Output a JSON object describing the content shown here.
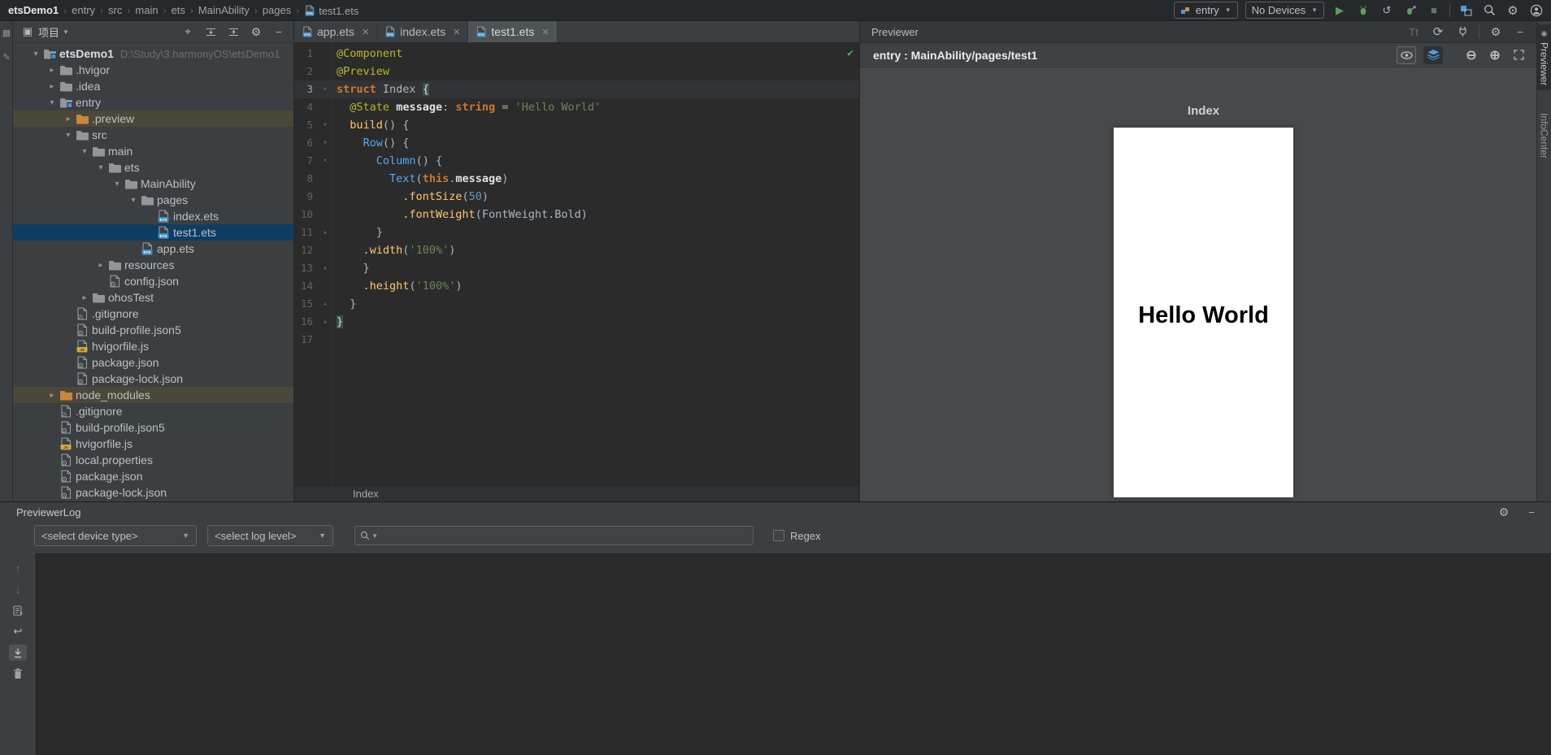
{
  "colors": {
    "editor_bg": "#2b2b2b",
    "panel_bg": "#3c3f41",
    "preview_surface": "#47494b",
    "selection_blue": "#0e3d64",
    "library_row_olive": "#4b4839",
    "annotation_yellow": "#bbb529",
    "keyword_orange": "#cc7832",
    "component_blue": "#56a8f5",
    "function_yellow": "#ffc66d",
    "string_green": "#6a8759",
    "number_blue": "#6897bb",
    "run_green": "#5c9e5b",
    "phone_bg": "#ffffff",
    "preview_text_color": "#000000"
  },
  "icons": {
    "play": "▶",
    "stop": "■",
    "rerun": "↺",
    "gear": "⚙",
    "minus": "−",
    "target": "⌖",
    "refresh": "⟳",
    "tt": "Tt",
    "zoom_in": "⊕",
    "zoom_out": "⊖",
    "chevron_down": "▾",
    "chevron_right": "▸",
    "dropdown_arrow": "▼",
    "up": "↑",
    "down": "↓",
    "wrap": "↩",
    "grid": "▦",
    "edit": "✎",
    "check": "✔",
    "eye": "◉",
    "project": "▣"
  },
  "title_bar": {
    "breadcrumbs": [
      "etsDemo1",
      "entry",
      "src",
      "main",
      "ets",
      "MainAbility",
      "pages",
      "test1.ets"
    ],
    "run_config": "entry",
    "device_selector": "No Devices"
  },
  "project_panel": {
    "title": "项目",
    "tree": [
      {
        "label": "etsDemo1",
        "suffix": "D:\\Study\\3.harmonyOS\\etsDemo1",
        "depth": 0,
        "icon": "folder-project",
        "chevron": "expanded",
        "state": "none"
      },
      {
        "label": ".hvigor",
        "depth": 1,
        "icon": "folder",
        "chevron": "collapsed",
        "state": "none"
      },
      {
        "label": ".idea",
        "depth": 1,
        "icon": "folder",
        "chevron": "collapsed",
        "state": "none"
      },
      {
        "label": "entry",
        "depth": 1,
        "icon": "folder-module",
        "chevron": "expanded",
        "state": "none"
      },
      {
        "label": ".preview",
        "depth": 2,
        "icon": "folder-orange",
        "chevron": "collapsed",
        "state": "olive"
      },
      {
        "label": "src",
        "depth": 2,
        "icon": "folder",
        "chevron": "expanded",
        "state": "none"
      },
      {
        "label": "main",
        "depth": 3,
        "icon": "folder",
        "chevron": "expanded",
        "state": "none"
      },
      {
        "label": "ets",
        "depth": 4,
        "icon": "folder",
        "chevron": "expanded",
        "state": "none"
      },
      {
        "label": "MainAbility",
        "depth": 5,
        "icon": "folder",
        "chevron": "expanded",
        "state": "none"
      },
      {
        "label": "pages",
        "depth": 6,
        "icon": "folder",
        "chevron": "expanded",
        "state": "none"
      },
      {
        "label": "index.ets",
        "depth": 7,
        "icon": "ets",
        "chevron": "none",
        "state": "none"
      },
      {
        "label": "test1.ets",
        "depth": 7,
        "icon": "ets",
        "chevron": "none",
        "state": "selected"
      },
      {
        "label": "app.ets",
        "depth": 6,
        "icon": "ets",
        "chevron": "none",
        "state": "none"
      },
      {
        "label": "resources",
        "depth": 4,
        "icon": "folder",
        "chevron": "collapsed",
        "state": "none"
      },
      {
        "label": "config.json",
        "depth": 4,
        "icon": "json",
        "chevron": "none",
        "state": "none"
      },
      {
        "label": "ohosTest",
        "depth": 3,
        "icon": "folder",
        "chevron": "collapsed",
        "state": "none"
      },
      {
        "label": ".gitignore",
        "depth": 2,
        "icon": "ignore",
        "chevron": "none",
        "state": "none"
      },
      {
        "label": "build-profile.json5",
        "depth": 2,
        "icon": "json",
        "chevron": "none",
        "state": "none"
      },
      {
        "label": "hvigorfile.js",
        "depth": 2,
        "icon": "js",
        "chevron": "none",
        "state": "none"
      },
      {
        "label": "package.json",
        "depth": 2,
        "icon": "json",
        "chevron": "none",
        "state": "none"
      },
      {
        "label": "package-lock.json",
        "depth": 2,
        "icon": "json",
        "chevron": "none",
        "state": "none"
      },
      {
        "label": "node_modules",
        "depth": 1,
        "icon": "folder-orange",
        "chevron": "collapsed",
        "state": "olive"
      },
      {
        "label": ".gitignore",
        "depth": 1,
        "icon": "ignore",
        "chevron": "none",
        "state": "none"
      },
      {
        "label": "build-profile.json5",
        "depth": 1,
        "icon": "json",
        "chevron": "none",
        "state": "none"
      },
      {
        "label": "hvigorfile.js",
        "depth": 1,
        "icon": "js",
        "chevron": "none",
        "state": "none"
      },
      {
        "label": "local.properties",
        "depth": 1,
        "icon": "props",
        "chevron": "none",
        "state": "none"
      },
      {
        "label": "package.json",
        "depth": 1,
        "icon": "json",
        "chevron": "none",
        "state": "none"
      },
      {
        "label": "package-lock.json",
        "depth": 1,
        "icon": "json",
        "chevron": "none",
        "state": "none"
      }
    ]
  },
  "editor": {
    "tabs": [
      {
        "label": "app.ets",
        "active": false
      },
      {
        "label": "index.ets",
        "active": false
      },
      {
        "label": "test1.ets",
        "active": true
      }
    ],
    "status_breadcrumb": "Index",
    "lines": [
      {
        "num": 1,
        "fold": null,
        "caret": false,
        "tokens": [
          {
            "t": "ann",
            "s": "@Component"
          }
        ]
      },
      {
        "num": 2,
        "fold": null,
        "caret": false,
        "tokens": [
          {
            "t": "ann",
            "s": "@Preview"
          }
        ]
      },
      {
        "num": 3,
        "fold": "start",
        "caret": true,
        "tokens": [
          {
            "t": "kw",
            "s": "struct "
          },
          {
            "t": "plain",
            "s": "Index "
          },
          {
            "t": "bracehl",
            "s": "{"
          }
        ]
      },
      {
        "num": 4,
        "fold": null,
        "caret": false,
        "tokens": [
          {
            "t": "plain",
            "s": "  "
          },
          {
            "t": "ann",
            "s": "@State"
          },
          {
            "t": "plain",
            "s": " "
          },
          {
            "t": "field",
            "s": "message"
          },
          {
            "t": "plain",
            "s": ": "
          },
          {
            "t": "kw",
            "s": "string"
          },
          {
            "t": "plain",
            "s": " = "
          },
          {
            "t": "str",
            "s": "'Hello World'"
          }
        ]
      },
      {
        "num": 5,
        "fold": "start",
        "caret": false,
        "tokens": [
          {
            "t": "plain",
            "s": "  "
          },
          {
            "t": "func",
            "s": "build"
          },
          {
            "t": "plain",
            "s": "() {"
          }
        ]
      },
      {
        "num": 6,
        "fold": "start",
        "caret": false,
        "tokens": [
          {
            "t": "plain",
            "s": "    "
          },
          {
            "t": "comp",
            "s": "Row"
          },
          {
            "t": "plain",
            "s": "() {"
          }
        ]
      },
      {
        "num": 7,
        "fold": "start",
        "caret": false,
        "tokens": [
          {
            "t": "plain",
            "s": "      "
          },
          {
            "t": "comp",
            "s": "Column"
          },
          {
            "t": "plain",
            "s": "() {"
          }
        ]
      },
      {
        "num": 8,
        "fold": null,
        "caret": false,
        "tokens": [
          {
            "t": "plain",
            "s": "        "
          },
          {
            "t": "comp",
            "s": "Text"
          },
          {
            "t": "plain",
            "s": "("
          },
          {
            "t": "kw",
            "s": "this"
          },
          {
            "t": "plain",
            "s": "."
          },
          {
            "t": "field",
            "s": "message"
          },
          {
            "t": "plain",
            "s": ")"
          }
        ]
      },
      {
        "num": 9,
        "fold": null,
        "caret": false,
        "tokens": [
          {
            "t": "plain",
            "s": "          "
          },
          {
            "t": "func",
            "s": ".fontSize"
          },
          {
            "t": "plain",
            "s": "("
          },
          {
            "t": "num",
            "s": "50"
          },
          {
            "t": "plain",
            "s": ")"
          }
        ]
      },
      {
        "num": 10,
        "fold": null,
        "caret": false,
        "tokens": [
          {
            "t": "plain",
            "s": "          "
          },
          {
            "t": "func",
            "s": ".fontWeight"
          },
          {
            "t": "plain",
            "s": "("
          },
          {
            "t": "plain",
            "s": "FontWeight.Bold"
          },
          {
            "t": "plain",
            "s": ")"
          }
        ]
      },
      {
        "num": 11,
        "fold": "end",
        "caret": false,
        "tokens": [
          {
            "t": "plain",
            "s": "      }"
          }
        ]
      },
      {
        "num": 12,
        "fold": null,
        "caret": false,
        "tokens": [
          {
            "t": "plain",
            "s": "    "
          },
          {
            "t": "func",
            "s": ".width"
          },
          {
            "t": "plain",
            "s": "("
          },
          {
            "t": "str",
            "s": "'100%'"
          },
          {
            "t": "plain",
            "s": ")"
          }
        ]
      },
      {
        "num": 13,
        "fold": "end",
        "caret": false,
        "tokens": [
          {
            "t": "plain",
            "s": "    }"
          }
        ]
      },
      {
        "num": 14,
        "fold": null,
        "caret": false,
        "tokens": [
          {
            "t": "plain",
            "s": "    "
          },
          {
            "t": "func",
            "s": ".height"
          },
          {
            "t": "plain",
            "s": "("
          },
          {
            "t": "str",
            "s": "'100%'"
          },
          {
            "t": "plain",
            "s": ")"
          }
        ]
      },
      {
        "num": 15,
        "fold": "end",
        "caret": false,
        "tokens": [
          {
            "t": "plain",
            "s": "  }"
          }
        ]
      },
      {
        "num": 16,
        "fold": "end",
        "caret": false,
        "tokens": [
          {
            "t": "bracehl",
            "s": "}"
          }
        ]
      },
      {
        "num": 17,
        "fold": null,
        "caret": false,
        "tokens": []
      }
    ]
  },
  "previewer": {
    "title": "Previewer",
    "config_label": "entry : MainAbility/pages/test1",
    "page_title": "Index",
    "preview_text": "Hello World"
  },
  "right_strip": {
    "tabs": [
      "Previewer",
      "InfoCenter"
    ]
  },
  "log_panel": {
    "title": "PreviewerLog",
    "device_filter": "<select device type>",
    "level_filter": "<select log level>",
    "regex_label": "Regex",
    "search_value": ""
  }
}
